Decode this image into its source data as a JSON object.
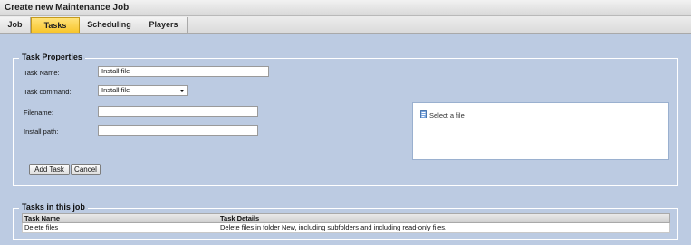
{
  "window": {
    "title": "Create new Maintenance Job"
  },
  "tabs": [
    {
      "label": "Job",
      "active": false
    },
    {
      "label": "Tasks",
      "active": true
    },
    {
      "label": "Scheduling",
      "active": false
    },
    {
      "label": "Players",
      "active": false
    }
  ],
  "task_properties": {
    "legend": "Task Properties",
    "task_name": {
      "label": "Task Name:",
      "value": "Install file"
    },
    "task_command": {
      "label": "Task command:",
      "value": "Install file"
    },
    "filename": {
      "label": "Filename:",
      "value": ""
    },
    "install_path": {
      "label": "Install path:",
      "value": ""
    },
    "file_browser": {
      "text": "Select a file",
      "icon": "file-icon"
    },
    "add_button": "Add Task",
    "cancel_button": "Cancel"
  },
  "tasks_in_job": {
    "legend": "Tasks in this job",
    "columns": [
      "Task Name",
      "Task Details"
    ],
    "rows": [
      [
        "Delete files",
        "Delete files in folder New, including subfolders and including read-only files."
      ]
    ]
  },
  "colors": {
    "panel_background": "#bccbe2",
    "active_tab": "#f8c52c"
  }
}
